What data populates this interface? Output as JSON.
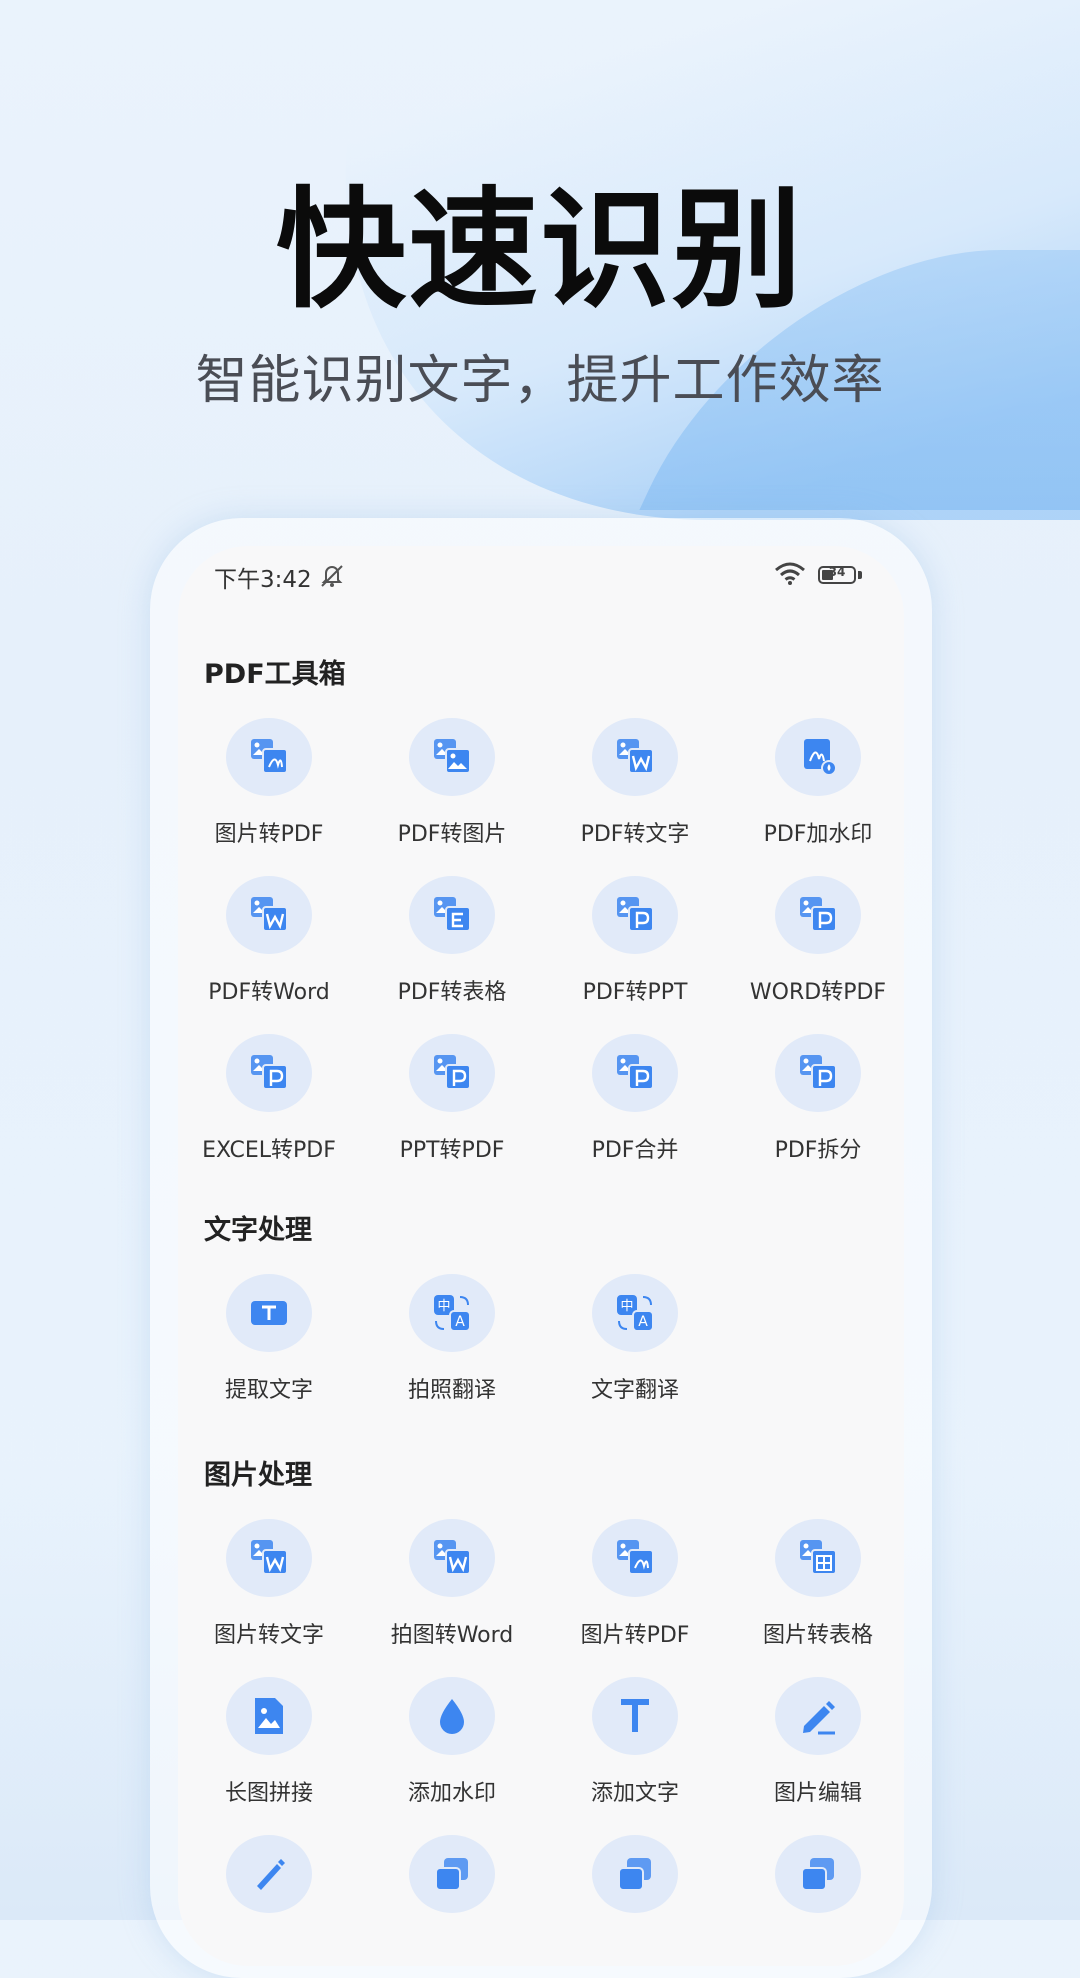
{
  "hero": {
    "title": "快速识别",
    "subtitle": "智能识别文字，提升工作效率"
  },
  "status_bar": {
    "time": "下午3:42",
    "battery": "34"
  },
  "sections": [
    {
      "title": "PDF工具箱",
      "items": [
        {
          "label": "图片转PDF",
          "icon": "image-to-pdf-icon"
        },
        {
          "label": "PDF转图片",
          "icon": "pdf-to-image-icon"
        },
        {
          "label": "PDF转文字",
          "icon": "pdf-to-text-icon"
        },
        {
          "label": "PDF加水印",
          "icon": "pdf-watermark-icon"
        },
        {
          "label": "PDF转Word",
          "icon": "pdf-to-word-icon"
        },
        {
          "label": "PDF转表格",
          "icon": "pdf-to-excel-icon"
        },
        {
          "label": "PDF转PPT",
          "icon": "pdf-to-ppt-icon"
        },
        {
          "label": "WORD转PDF",
          "icon": "word-to-pdf-icon"
        },
        {
          "label": "EXCEL转PDF",
          "icon": "excel-to-pdf-icon"
        },
        {
          "label": "PPT转PDF",
          "icon": "ppt-to-pdf-icon"
        },
        {
          "label": "PDF合并",
          "icon": "pdf-merge-icon"
        },
        {
          "label": "PDF拆分",
          "icon": "pdf-split-icon"
        }
      ]
    },
    {
      "title": "文字处理",
      "items": [
        {
          "label": "提取文字",
          "icon": "extract-text-icon"
        },
        {
          "label": "拍照翻译",
          "icon": "photo-translate-icon"
        },
        {
          "label": "文字翻译",
          "icon": "text-translate-icon"
        }
      ]
    },
    {
      "title": "图片处理",
      "items": [
        {
          "label": "图片转文字",
          "icon": "image-to-text-icon"
        },
        {
          "label": "拍图转Word",
          "icon": "photo-to-word-icon"
        },
        {
          "label": "图片转PDF",
          "icon": "image-to-pdf-icon"
        },
        {
          "label": "图片转表格",
          "icon": "image-to-table-icon"
        },
        {
          "label": "长图拼接",
          "icon": "long-image-stitch-icon"
        },
        {
          "label": "添加水印",
          "icon": "watermark-drop-icon"
        },
        {
          "label": "添加文字",
          "icon": "add-text-icon"
        },
        {
          "label": "图片编辑",
          "icon": "image-edit-pencil-icon"
        }
      ]
    }
  ],
  "partial_row_icons": [
    "brush-icon",
    "copy-icon",
    "copy-icon",
    "copy-icon"
  ],
  "colors": {
    "accent": "#3d86f0",
    "icon_bg": "#e1eaf9"
  }
}
